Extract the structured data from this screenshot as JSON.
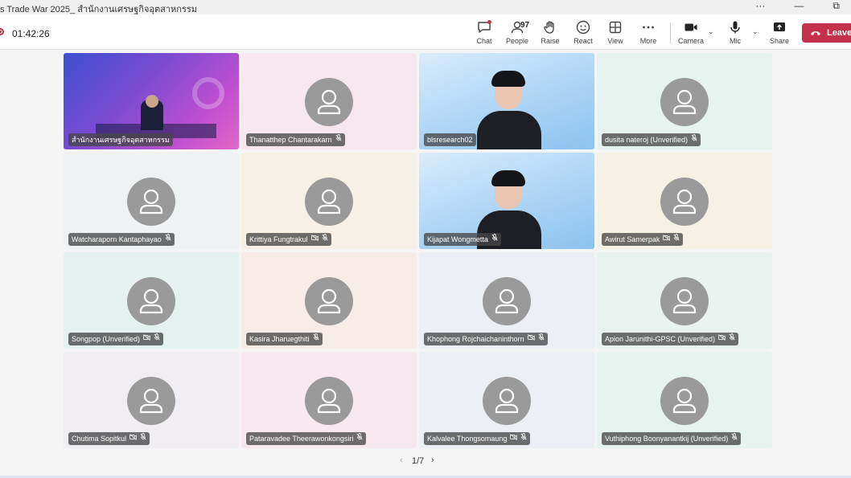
{
  "window": {
    "title": "s Trade War 2025_ สำนักงานเศรษฐกิจอุตสาหกรรม",
    "min_icon": "minimize-icon",
    "restore_icon": "restore-icon",
    "more_icon": "more-horizontal-icon"
  },
  "meeting": {
    "timer": "01:42:26",
    "recording_icon": "recording-icon"
  },
  "toolbar": {
    "chat": "Chat",
    "people": "People",
    "people_count": "97",
    "raise": "Raise",
    "react": "React",
    "view": "View",
    "more": "More",
    "camera": "Camera",
    "mic": "Mic",
    "share": "Share",
    "leave": "Leave"
  },
  "colors": {
    "leave_button": "#c4314b",
    "avatar_gray": "#9a9a9a"
  },
  "participants": [
    {
      "name": "สำนักงานเศรษฐกิจอุตสาหกรรม",
      "type": "presenter",
      "cam_off": false,
      "mic": false,
      "bg": "#7b4bd1"
    },
    {
      "name": "Thanatthep Chantarakarn",
      "type": "avatar",
      "cam_off": false,
      "mic": true,
      "bg": "#f7e8ef"
    },
    {
      "name": "blsresearch02",
      "type": "video",
      "cam_off": false,
      "mic": false,
      "bg": "#b8dbf6"
    },
    {
      "name": "dusita nateroj (Unverified)",
      "type": "avatar",
      "cam_off": false,
      "mic": true,
      "bg": "#e6f3ee"
    },
    {
      "name": "Watcharaporn Kantaphayao",
      "type": "avatar",
      "cam_off": false,
      "mic": true,
      "bg": "#eef2f3"
    },
    {
      "name": "Krittiya Fungtrakul",
      "type": "avatar",
      "cam_off": true,
      "mic": true,
      "bg": "#f6f0e6"
    },
    {
      "name": "Kijapat Wongmetta",
      "type": "video",
      "cam_off": false,
      "mic": true,
      "bg": "#b5d9f5"
    },
    {
      "name": "Awirut Samerpak",
      "type": "avatar",
      "cam_off": true,
      "mic": true,
      "bg": "#f5f1e4"
    },
    {
      "name": "Songpop (Unverified)",
      "type": "avatar",
      "cam_off": true,
      "mic": true,
      "bg": "#e5f2ef"
    },
    {
      "name": "Kasira Jharuegthiti",
      "type": "avatar",
      "cam_off": false,
      "mic": true,
      "bg": "#f6ece8"
    },
    {
      "name": "Khophong Rojchaichaninthorn",
      "type": "avatar",
      "cam_off": true,
      "mic": true,
      "bg": "#eceff3"
    },
    {
      "name": "Apion Jarunithi-GPSC (Unverified)",
      "type": "avatar",
      "cam_off": true,
      "mic": true,
      "bg": "#eaf3ef"
    },
    {
      "name": "Chutima Sopitkul",
      "type": "avatar",
      "cam_off": true,
      "mic": true,
      "bg": "#f1eef3"
    },
    {
      "name": "Pataravadee Theerawonkongsiri",
      "type": "avatar",
      "cam_off": false,
      "mic": true,
      "bg": "#f6eaf0"
    },
    {
      "name": "Kalvalee Thongsomaung",
      "type": "avatar",
      "cam_off": true,
      "mic": true,
      "bg": "#eceff4"
    },
    {
      "name": "Vuthiphong Boonyanantkij (Unverified)",
      "type": "avatar",
      "cam_off": false,
      "mic": true,
      "bg": "#e6f3ef"
    }
  ],
  "pager": {
    "label": "1/7",
    "prev_icon": "chevron-left-icon",
    "next_icon": "chevron-right-icon"
  }
}
